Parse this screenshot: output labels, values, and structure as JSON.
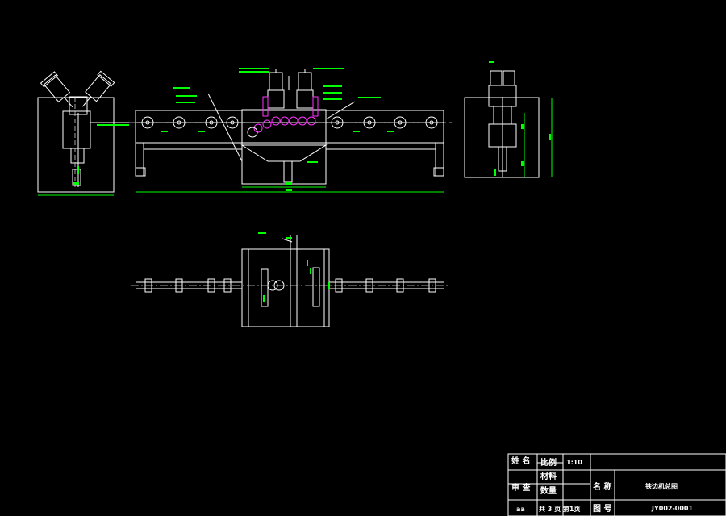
{
  "colors": {
    "background": "#000000",
    "line": "#ffffff",
    "dimension": "#00ff00",
    "highlight": "#ff33ff"
  },
  "title_block": {
    "name_label": "姓 名",
    "scale_label": "比例",
    "scale_value": "1:10",
    "material_label": "材料",
    "review_label": "审 查",
    "quantity_label": "数量",
    "title_label": "名 称",
    "drawing_title": "铁边机总图",
    "sheet_info": "共 3 页 第1页",
    "dwg_no_label": "图 号",
    "drawing_number": "JY002-0001",
    "corner_mark": "aa"
  }
}
